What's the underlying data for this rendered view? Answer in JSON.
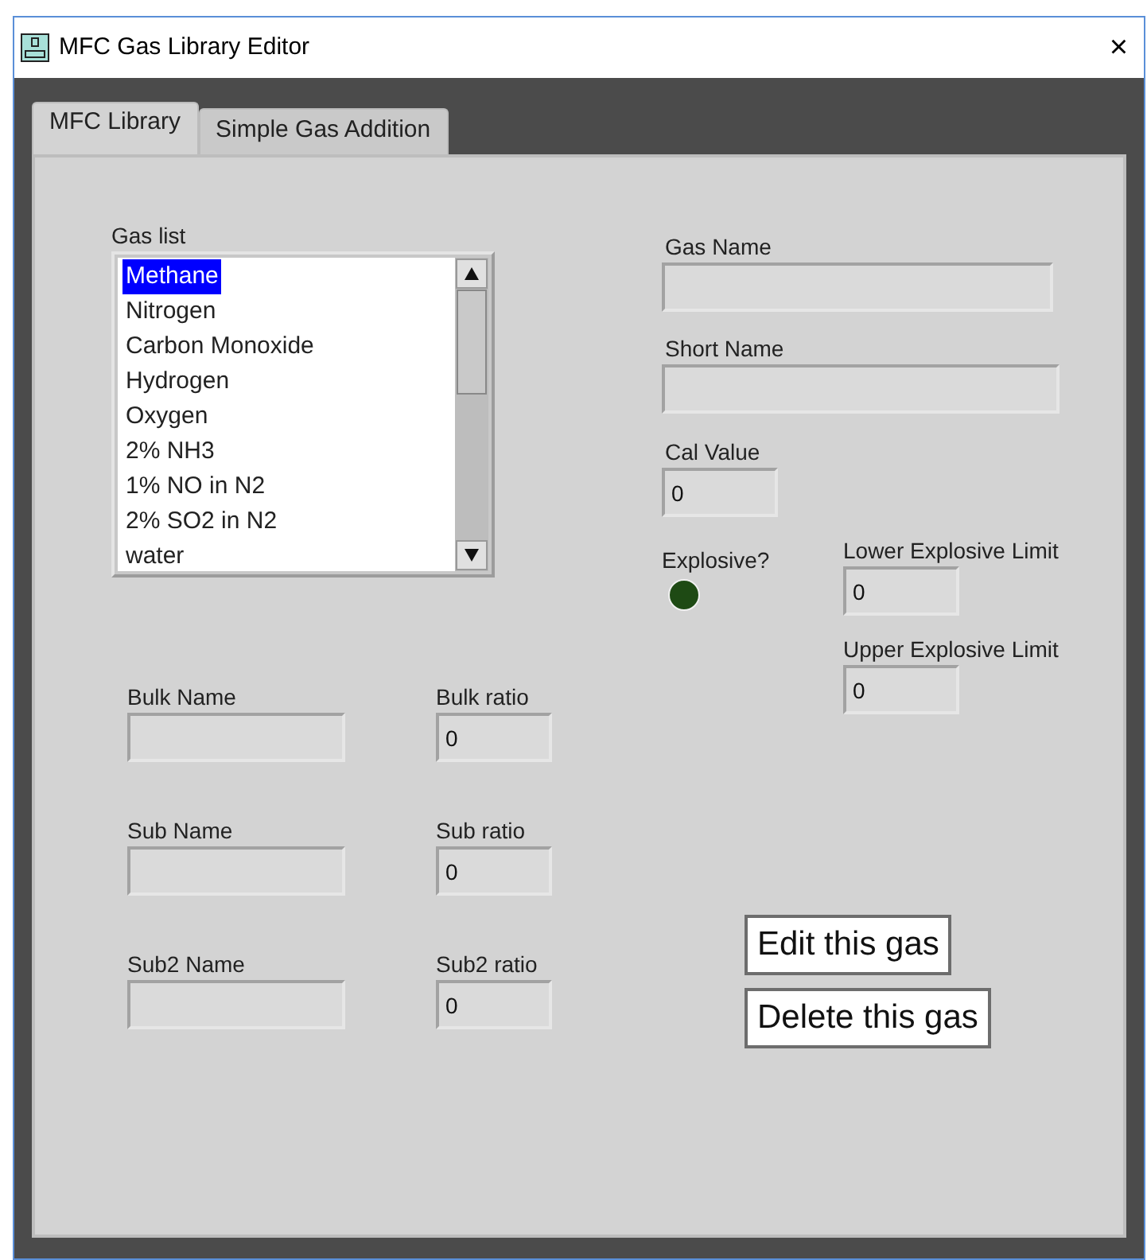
{
  "window": {
    "title": "MFC Gas Library Editor",
    "close": "×"
  },
  "tabs": [
    {
      "label": "MFC Library",
      "selected": true
    },
    {
      "label": "Simple Gas Addition",
      "selected": false
    }
  ],
  "gas_list": {
    "label": "Gas list",
    "items": [
      {
        "name": "Methane",
        "selected": true
      },
      {
        "name": "Nitrogen",
        "selected": false
      },
      {
        "name": "Carbon Monoxide",
        "selected": false
      },
      {
        "name": "Hydrogen",
        "selected": false
      },
      {
        "name": "Oxygen",
        "selected": false
      },
      {
        "name": "2% NH3",
        "selected": false
      },
      {
        "name": "1% NO in N2",
        "selected": false
      },
      {
        "name": "2% SO2 in N2",
        "selected": false
      },
      {
        "name": "water",
        "selected": false
      }
    ]
  },
  "gas_name": {
    "label": "Gas Name"
  },
  "short_name": {
    "label": "Short Name"
  },
  "cal_value": {
    "label": "Cal Value",
    "value": "0"
  },
  "explosive": {
    "label": "Explosive?",
    "on": false
  },
  "lower_explosive_limit": {
    "label": "Lower Explosive Limit",
    "value": "0"
  },
  "upper_explosive_limit": {
    "label": "Upper Explosive Limit",
    "value": "0"
  },
  "mixture": [
    {
      "name_label": "Bulk Name",
      "ratio_label": "Bulk ratio",
      "ratio": "0"
    },
    {
      "name_label": "Sub Name",
      "ratio_label": "Sub ratio",
      "ratio": "0"
    },
    {
      "name_label": "Sub2 Name",
      "ratio_label": "Sub2 ratio",
      "ratio": "0"
    }
  ],
  "buttons": [
    "Edit this gas",
    "Delete this gas"
  ]
}
